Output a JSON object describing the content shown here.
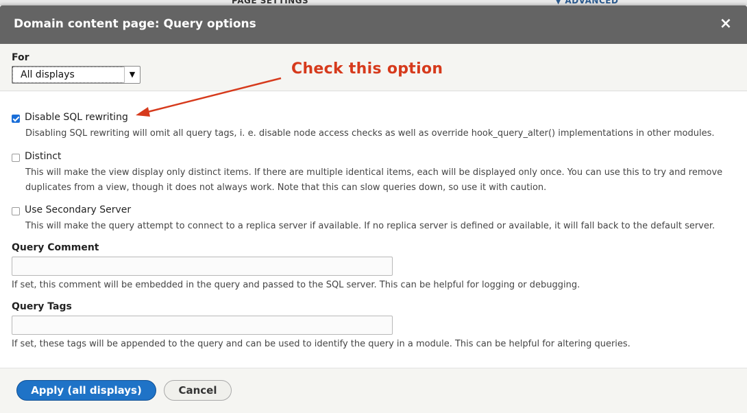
{
  "background": {
    "left_text": "PAGE SETTINGS",
    "right_text": "▼ ADVANCED"
  },
  "dialog": {
    "title": "Domain content page: Query options",
    "close_icon": "×"
  },
  "for_field": {
    "label": "For",
    "selected": "All displays"
  },
  "annotation": {
    "text": "Check this option",
    "color": "#d63a1c"
  },
  "options": [
    {
      "label": "Disable SQL rewriting",
      "checked": true,
      "description": "Disabling SQL rewriting will omit all query tags, i. e. disable node access checks as well as override hook_query_alter() implementations in other modules."
    },
    {
      "label": "Distinct",
      "checked": false,
      "description_line1": "This will make the view display only distinct items. If there are multiple identical items, each will be displayed only once. You can use this to try and remove",
      "description_line2": "duplicates from a view, though it does not always work. Note that this can slow queries down, so use it with caution."
    },
    {
      "label": "Use Secondary Server",
      "checked": false,
      "description": "This will make the query attempt to connect to a replica server if available. If no replica server is defined or available, it will fall back to the default server."
    }
  ],
  "query_comment": {
    "label": "Query Comment",
    "value": "",
    "description": "If set, this comment will be embedded in the query and passed to the SQL server. This can be helpful for logging or debugging."
  },
  "query_tags": {
    "label": "Query Tags",
    "value": "",
    "description": "If set, these tags will be appended to the query and can be used to identify the query in a module. This can be helpful for altering queries."
  },
  "footer": {
    "apply_label": "Apply (all displays)",
    "cancel_label": "Cancel"
  },
  "colors": {
    "titlebar": "#646464",
    "primary_button": "#1f73c7",
    "checkbox_checked": "#1a6ed8"
  }
}
